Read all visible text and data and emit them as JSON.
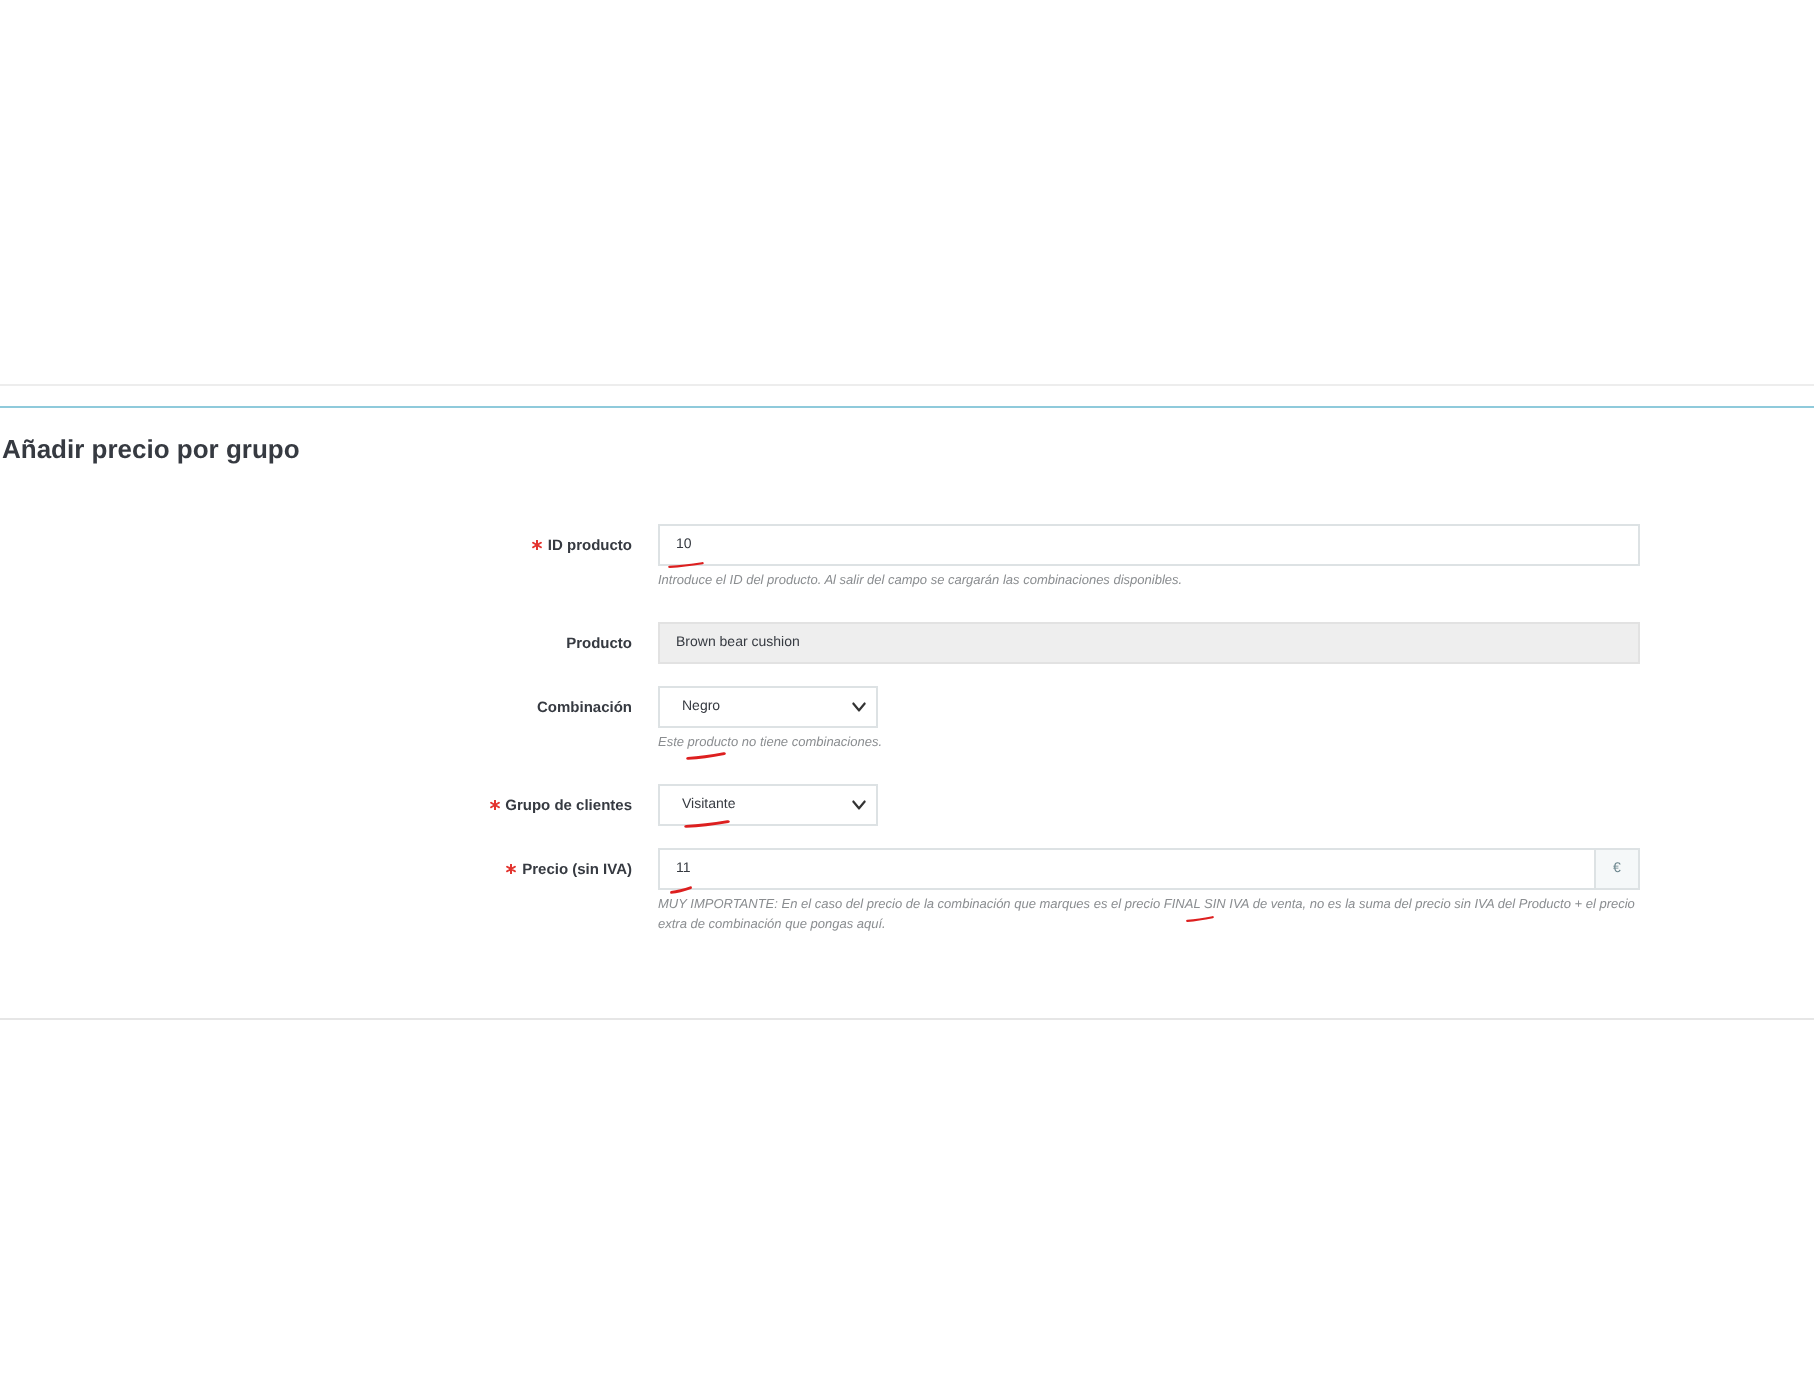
{
  "title": "Añadir precio por grupo",
  "fields": [
    {
      "kind": "text",
      "label": "ID producto",
      "required": true,
      "value": "10",
      "value_marked": true,
      "help": "Introduce el ID del producto. Al salir del campo se cargarán las combinaciones disponibles.",
      "help_marked": false
    },
    {
      "kind": "readonly",
      "label": "Producto",
      "required": false,
      "value": "Brown bear cushion",
      "value_marked": false
    },
    {
      "kind": "select",
      "label": "Combinación",
      "required": false,
      "value": "Negro",
      "value_marked": false,
      "help": "Este producto no tiene combinaciones.",
      "help_marked": true
    },
    {
      "kind": "select",
      "label": "Grupo de clientes",
      "required": true,
      "value": "Visitante",
      "value_marked": true
    },
    {
      "kind": "addon",
      "label": "Precio (sin IVA)",
      "required": true,
      "value": "11",
      "value_marked": true,
      "addon": "€",
      "help": "MUY IMPORTANTE: En el caso del precio de la combinación que marques es el precio FINAL SIN IVA de venta, no es la suma del precio sin IVA del Producto + el precio extra de combinación que pongas aquí.",
      "help_marked": true
    }
  ]
}
